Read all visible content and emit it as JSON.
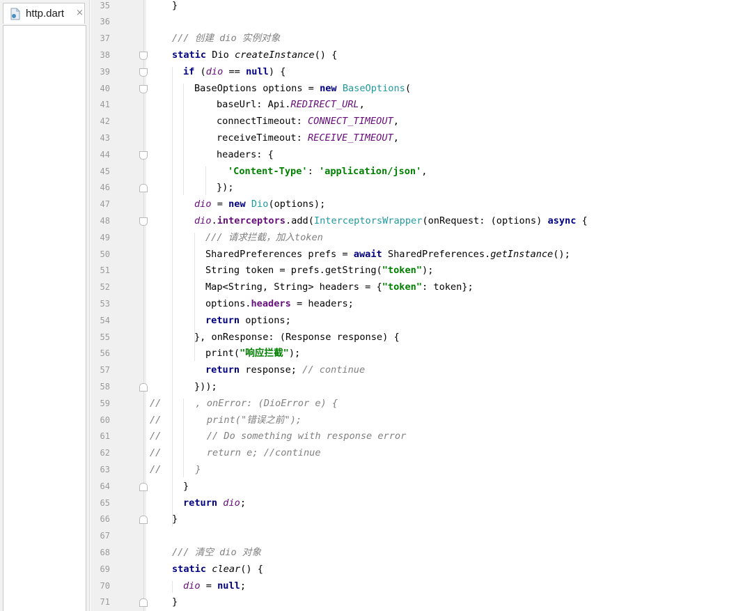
{
  "tab": {
    "filename": "http.dart",
    "close_glyph": "×",
    "icon": "dart-file-icon"
  },
  "code": {
    "lines": [
      {
        "n": "35",
        "text": "}"
      },
      {
        "n": "36",
        "text": ""
      },
      {
        "n": "37",
        "text": "/// 创建 dio 实例对象"
      },
      {
        "n": "38",
        "text": "static Dio createInstance() {"
      },
      {
        "n": "39",
        "text": "if (dio == null) {"
      },
      {
        "n": "40",
        "text": "BaseOptions options = new BaseOptions("
      },
      {
        "n": "41",
        "text": "baseUrl: Api.REDIRECT_URL,"
      },
      {
        "n": "42",
        "text": "connectTimeout: CONNECT_TIMEOUT,"
      },
      {
        "n": "43",
        "text": "receiveTimeout: RECEIVE_TIMEOUT,"
      },
      {
        "n": "44",
        "text": "headers: {"
      },
      {
        "n": "45",
        "text": "'Content-Type': 'application/json',"
      },
      {
        "n": "46",
        "text": "});"
      },
      {
        "n": "47",
        "text": "dio = new Dio(options);"
      },
      {
        "n": "48",
        "text": "dio.interceptors.add(InterceptorsWrapper(onRequest: (options) async {"
      },
      {
        "n": "49",
        "text": "/// 请求拦截，加入token"
      },
      {
        "n": "50",
        "text": "SharedPreferences prefs = await SharedPreferences.getInstance();"
      },
      {
        "n": "51",
        "text": "String token = prefs.getString(\"token\");"
      },
      {
        "n": "52",
        "text": "Map<String, String> headers = {\"token\": token};"
      },
      {
        "n": "53",
        "text": "options.headers = headers;"
      },
      {
        "n": "54",
        "text": "return options;"
      },
      {
        "n": "55",
        "text": "}, onResponse: (Response response) {"
      },
      {
        "n": "56",
        "text": "print(\"响应拦截\");"
      },
      {
        "n": "57",
        "text": "return response; // continue"
      },
      {
        "n": "58",
        "text": "}));"
      },
      {
        "n": "59",
        "text": "//      , onError: (DioError e) {"
      },
      {
        "n": "60",
        "text": "//        print(\"错误之前\");"
      },
      {
        "n": "61",
        "text": "//        // Do something with response error"
      },
      {
        "n": "62",
        "text": "//        return e; //continue"
      },
      {
        "n": "63",
        "text": "//      }"
      },
      {
        "n": "64",
        "text": "}"
      },
      {
        "n": "65",
        "text": "return dio;"
      },
      {
        "n": "66",
        "text": "}"
      },
      {
        "n": "67",
        "text": ""
      },
      {
        "n": "68",
        "text": "/// 清空 dio 对象"
      },
      {
        "n": "69",
        "text": "static clear() {"
      },
      {
        "n": "70",
        "text": "dio = null;"
      },
      {
        "n": "71",
        "text": "}"
      }
    ],
    "fold_start_lines": [
      "38",
      "39",
      "40",
      "44",
      "48"
    ],
    "fold_end_lines": [
      "46",
      "58",
      "64",
      "66",
      "71"
    ],
    "comment_marker_lines": [
      "59",
      "60",
      "61",
      "62",
      "63"
    ],
    "colors": {
      "keyword": "#000080",
      "class_ref": "#20999d",
      "field": "#660e7a",
      "string": "#008000",
      "comment": "#808080",
      "gutter_bg": "#f0f0f0"
    }
  }
}
